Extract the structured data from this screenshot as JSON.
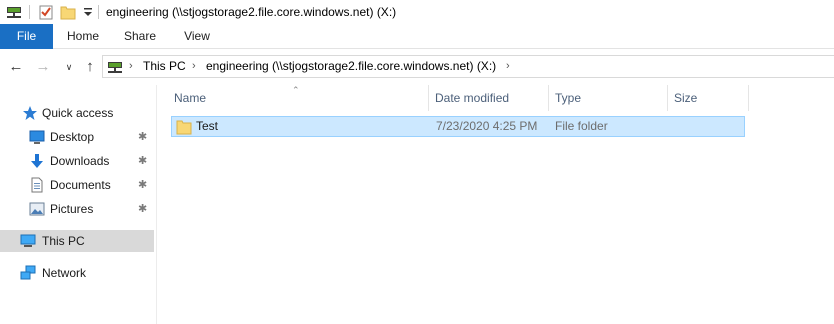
{
  "window": {
    "title": "engineering (\\\\stjogstorage2.file.core.windows.net) (X:)"
  },
  "quick_access_toolbar": {
    "icons": [
      "network-drive-icon",
      "properties-check-icon",
      "new-folder-icon",
      "customize-dropdown-icon"
    ]
  },
  "ribbon": {
    "tabs": [
      {
        "label": "File"
      },
      {
        "label": "Home"
      },
      {
        "label": "Share"
      },
      {
        "label": "View"
      }
    ]
  },
  "navigation": {
    "back_icon": "back-arrow-icon",
    "forward_icon": "forward-arrow-icon",
    "recent_icon": "chevron-down-icon",
    "up_icon": "up-arrow-icon"
  },
  "address": {
    "crumbs": [
      {
        "label": "This PC"
      },
      {
        "label": "engineering (\\\\stjogstorage2.file.core.windows.net) (X:)"
      }
    ]
  },
  "sidebar": {
    "items": [
      {
        "label": "Quick access",
        "icon": "star-icon"
      },
      {
        "label": "Desktop",
        "icon": "desktop-icon",
        "pinned": true
      },
      {
        "label": "Downloads",
        "icon": "download-icon",
        "pinned": true
      },
      {
        "label": "Documents",
        "icon": "documents-icon",
        "pinned": true
      },
      {
        "label": "Pictures",
        "icon": "pictures-icon",
        "pinned": true
      },
      {
        "label": "This PC",
        "icon": "computer-icon",
        "selected": true
      },
      {
        "label": "Network",
        "icon": "network-icon"
      }
    ]
  },
  "file_list": {
    "columns": [
      {
        "label": "Name"
      },
      {
        "label": "Date modified"
      },
      {
        "label": "Type"
      },
      {
        "label": "Size"
      }
    ],
    "rows": [
      {
        "name": "Test",
        "date_modified": "7/23/2020 4:25 PM",
        "type": "File folder",
        "size": "",
        "selected": true,
        "icon": "folder-icon"
      }
    ]
  },
  "colors": {
    "file_tab": "#1a6fc4",
    "selection_fill": "#cce8ff",
    "selection_border": "#99d1ff",
    "sidebar_selected": "#d9d9d9",
    "column_header_text": "#4c607a"
  }
}
